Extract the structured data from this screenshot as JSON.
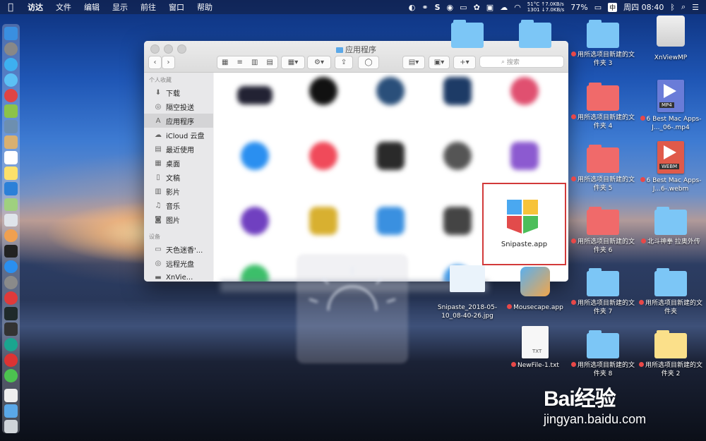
{
  "menubar": {
    "app": "访达",
    "items": [
      "文件",
      "编辑",
      "显示",
      "前往",
      "窗口",
      "帮助"
    ],
    "stat_left": [
      "51°C",
      "1301"
    ],
    "stat_right": [
      "↑7.0KB/s",
      "↓7.0KB/s"
    ],
    "battery": "77%",
    "input_method": "中",
    "clock": "周四 08:40"
  },
  "finder": {
    "title": "应用程序",
    "search_placeholder": "搜索",
    "sidebar": {
      "favorites_header": "个人收藏",
      "favorites": [
        {
          "label": "下载",
          "icon": "download-icon"
        },
        {
          "label": "隔空投送",
          "icon": "airdrop-icon"
        },
        {
          "label": "应用程序",
          "icon": "applications-icon",
          "selected": true
        },
        {
          "label": "iCloud 云盘",
          "icon": "cloud-icon"
        },
        {
          "label": "最近使用",
          "icon": "recents-icon"
        },
        {
          "label": "桌面",
          "icon": "desktop-icon"
        },
        {
          "label": "文稿",
          "icon": "documents-icon"
        },
        {
          "label": "影片",
          "icon": "movies-icon"
        },
        {
          "label": "音乐",
          "icon": "music-icon"
        },
        {
          "label": "图片",
          "icon": "pictures-icon"
        }
      ],
      "devices_header": "设备",
      "devices": [
        {
          "label": "天色迷香'...",
          "icon": "computer-icon"
        },
        {
          "label": "远程光盘",
          "icon": "disc-icon"
        },
        {
          "label": "XnVie...",
          "icon": "drive-icon"
        }
      ]
    },
    "snipaste_label": "Snipaste.app"
  },
  "desktop": {
    "items": [
      {
        "label": "用所选项目新建的文件夹 3",
        "kind": "folder",
        "color": "#7cc6f6",
        "tagged": true
      },
      {
        "label": "XnViewMP",
        "kind": "drive",
        "tagged": false
      },
      {
        "label": "用所选项目新建的文件夹 4",
        "kind": "folder",
        "color": "#f06a6a",
        "tagged": true
      },
      {
        "label": "6 Best Mac Apps- J..._06-.mp4",
        "kind": "video",
        "badge": "MP4",
        "tagged": true
      },
      {
        "label": "用所选项目新建的文件夹 5",
        "kind": "folder",
        "color": "#f06a6a",
        "tagged": true
      },
      {
        "label": "6 Best Mac Apps- J...6-.webm",
        "kind": "video",
        "badge": "WEBM",
        "tagged": true
      },
      {
        "label": "用所选项目新建的文件夹 6",
        "kind": "folder",
        "color": "#f06a6a",
        "tagged": true
      },
      {
        "label": "北斗神拳 拉奥外传",
        "kind": "folder",
        "color": "#7cc6f6",
        "tagged": true
      },
      {
        "label": "Snipaste_2018-05-10_08-40-26.jpg",
        "kind": "image",
        "tagged": false
      },
      {
        "label": "Mousecape.app",
        "kind": "app",
        "tagged": true
      },
      {
        "label": "用所选项目新建的文件夹 7",
        "kind": "folder",
        "color": "#7cc6f6",
        "tagged": true
      },
      {
        "label": "用所选项目新建的文件夹",
        "kind": "folder",
        "color": "#7cc6f6",
        "tagged": true
      },
      {
        "label": "NewFile-1.txt",
        "kind": "text",
        "badge": "TXT",
        "tagged": true
      },
      {
        "label": "用所选项目新建的文件夹 8",
        "kind": "folder",
        "color": "#7cc6f6",
        "tagged": true
      },
      {
        "label": "用所选项目新建的文件夹 2",
        "kind": "folder",
        "color": "#fbe08a",
        "tagged": true
      }
    ]
  },
  "watermark": {
    "line1": "Bai经验",
    "line2": "jingyan.baidu.com"
  }
}
